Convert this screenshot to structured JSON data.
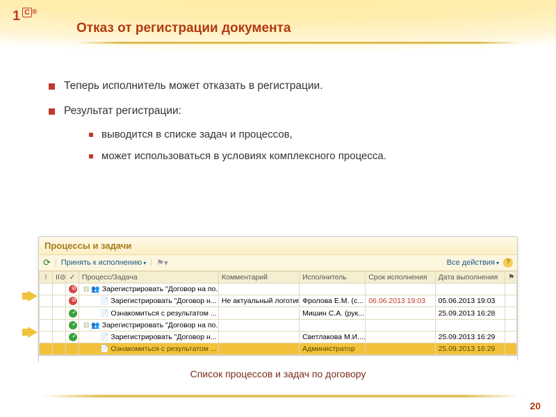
{
  "title": "Отказ от регистрации документа",
  "bullets": {
    "b1": "Теперь исполнитель может отказать в регистрации.",
    "b2": "Результат регистрации:",
    "sub1": "выводится в списке задач и процессов,",
    "sub2": "может использоваться в условиях комплексного процесса."
  },
  "panel": {
    "title": "Процессы и задачи",
    "toolbar": {
      "accept": "Принять к исполнению",
      "all_actions": "Все действия"
    },
    "columns": {
      "col_exc": "!",
      "col_pause": "II⊘",
      "col_check": "✓",
      "col_task": "Процесс/Задача",
      "col_comment": "Комментарий",
      "col_executor": "Исполнитель",
      "col_deadline": "Срок исполнения",
      "col_done": "Дата выполнения",
      "col_flag": "⚑"
    },
    "rows": [
      {
        "status": "red",
        "indent": 0,
        "icon": "tree",
        "task": "Зарегистрировать \"Договор на по...",
        "comment": "",
        "executor": "",
        "deadline": "",
        "done": ""
      },
      {
        "status": "red",
        "indent": 1,
        "icon": "paper",
        "task": "Зарегистрировать \"Договор н...",
        "comment": "Не актуальный логотип.",
        "executor": "Фролова Е.М. (с...",
        "deadline": "06.06.2013 19:03",
        "done": "05.06.2013 19:03"
      },
      {
        "status": "green",
        "indent": 1,
        "icon": "paper",
        "task": "Ознакомиться с результатом ...",
        "comment": "",
        "executor": "Мишин С.А. (рук...",
        "deadline": "",
        "done": "25.09.2013 16:28"
      },
      {
        "status": "green",
        "indent": 0,
        "icon": "tree",
        "task": "Зарегистрировать \"Договор на по...",
        "comment": "",
        "executor": "",
        "deadline": "",
        "done": ""
      },
      {
        "status": "green",
        "indent": 1,
        "icon": "paper",
        "task": "Зарегистрировать \"Договор н...",
        "comment": "",
        "executor": "Светлакова М.И....",
        "deadline": "",
        "done": "25.09.2013 16:29"
      },
      {
        "status": "",
        "indent": 1,
        "icon": "paper",
        "task": "Ознакомиться с результатом ...",
        "comment": "",
        "executor": "Администратор",
        "deadline": "",
        "done": "25.09.2013 16:29",
        "selected": true
      }
    ]
  },
  "caption": "Список процессов и задач по договору",
  "page": "20"
}
